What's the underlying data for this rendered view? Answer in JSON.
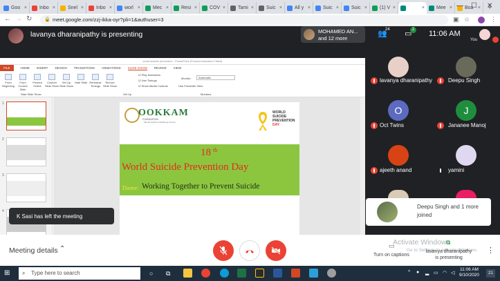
{
  "browser": {
    "tabs": [
      {
        "label": "Goo",
        "color": "#4285f4"
      },
      {
        "label": "Inbo",
        "color": "#ea4335"
      },
      {
        "label": "Snel",
        "color": "#f4b400"
      },
      {
        "label": "Inbo",
        "color": "#ea4335"
      },
      {
        "label": "worl",
        "color": "#4285f4"
      },
      {
        "label": "Mec",
        "color": "#0f9d58"
      },
      {
        "label": "Resi",
        "color": "#0f9d58"
      },
      {
        "label": "COV",
        "color": "#0f9d58"
      },
      {
        "label": "Tami",
        "color": "#5f6368"
      },
      {
        "label": "Suic",
        "color": "#5f6368"
      },
      {
        "label": "All y",
        "color": "#4285f4"
      },
      {
        "label": "Suic",
        "color": "#4285f4"
      },
      {
        "label": "Suic",
        "color": "#4285f4"
      },
      {
        "label": "(1) V",
        "color": "#0f9d58"
      },
      {
        "label": "",
        "color": "#00897b",
        "active": true
      },
      {
        "label": "Mee",
        "color": "#00897b"
      },
      {
        "label": "Boa",
        "color": "#f4b400"
      }
    ],
    "url": "meet.google.com/zzj-ikka-oyr?pli=1&authuser=3",
    "new_tab": "+",
    "minimize": "—",
    "maximize": "☐",
    "close": "✕"
  },
  "meet": {
    "presenter_text": "lavanya dharanipathy is presenting",
    "top_tile_line1": "MOHAMED AN...",
    "top_tile_line2": "and 12 more",
    "people_count": "24",
    "chat_count": "2",
    "time": "11:06 AM",
    "you_label": "You",
    "participants": [
      {
        "name": "lavanya dharanipathy",
        "initial": "",
        "color": "#e8d0c8",
        "muted": true
      },
      {
        "name": "Deepu Singh",
        "initial": "",
        "color": "#6a6a5a",
        "muted": true
      },
      {
        "name": "Oct Twins",
        "initial": "O",
        "color": "#5c6bc0",
        "muted": true
      },
      {
        "name": "Jananee Manoj",
        "initial": "J",
        "color": "#1e8e3e",
        "muted": true
      },
      {
        "name": "ajeeth anand",
        "initial": "",
        "color": "#d84315",
        "muted": true
      },
      {
        "name": "yamini",
        "initial": "",
        "color": "#e0d8f0",
        "muted": false
      }
    ],
    "left_toast": "K Sasi has left the meeting",
    "joined_toast": "Deepu Singh and 1 more joined",
    "meeting_details": "Meeting details",
    "captions": "Turn on captions",
    "watermark_title": "Activate Windows",
    "watermark_sub": "Go to Settings to activate Windows.",
    "presenting_label": "lavanya dharanipathy is presenting"
  },
  "ppt": {
    "title": "world suicide prevention - PowerPoint (Product Activation Failed)",
    "sign_in": "Sign in",
    "tabs": [
      "FILE",
      "HOME",
      "INSERT",
      "DESIGN",
      "TRANSITIONS",
      "ANIMATIONS",
      "SLIDE SHOW",
      "REVIEW",
      "VIEW"
    ],
    "selected_tab": "SLIDE SHOW",
    "ribbon_buttons": [
      "From Beginning",
      "From Current Slide",
      "Present Online",
      "Custom Slide Show",
      "Set Up Slide Show",
      "Hide Slide",
      "Rehearse Timings",
      "Record Slide Show"
    ],
    "checkboxes": [
      "Play Narrations",
      "Use Timings",
      "Show Media Controls"
    ],
    "monitor_label": "Monitor:",
    "monitor_value": "Automatic",
    "presenter_view": "Use Presenter View",
    "group_start": "Start Slide Show",
    "group_setup": "Set Up",
    "group_monitors": "Monitors",
    "thumb_numbers": [
      "1",
      "2",
      "3",
      "4"
    ],
    "slide": {
      "logo_name": "OOKKAM",
      "logo_sub": "FOUNDATION",
      "logo_tag": "Mental Health & Wellbeing Society",
      "wspd_line1": "WORLD",
      "wspd_line2": "SUICIDE",
      "wspd_line3": "PREVENTION",
      "wspd_line4": "DAY",
      "ordinal_number": "18",
      "ordinal_suffix": "th",
      "title": "World Suicide Prevention Day",
      "theme_label": "Theme:",
      "theme_text": "Working Together to Prevent Suicide"
    }
  },
  "taskbar": {
    "search_placeholder": "Type here to search",
    "time": "11:06 AM",
    "date": "9/10/2020",
    "notif_count": "21"
  }
}
